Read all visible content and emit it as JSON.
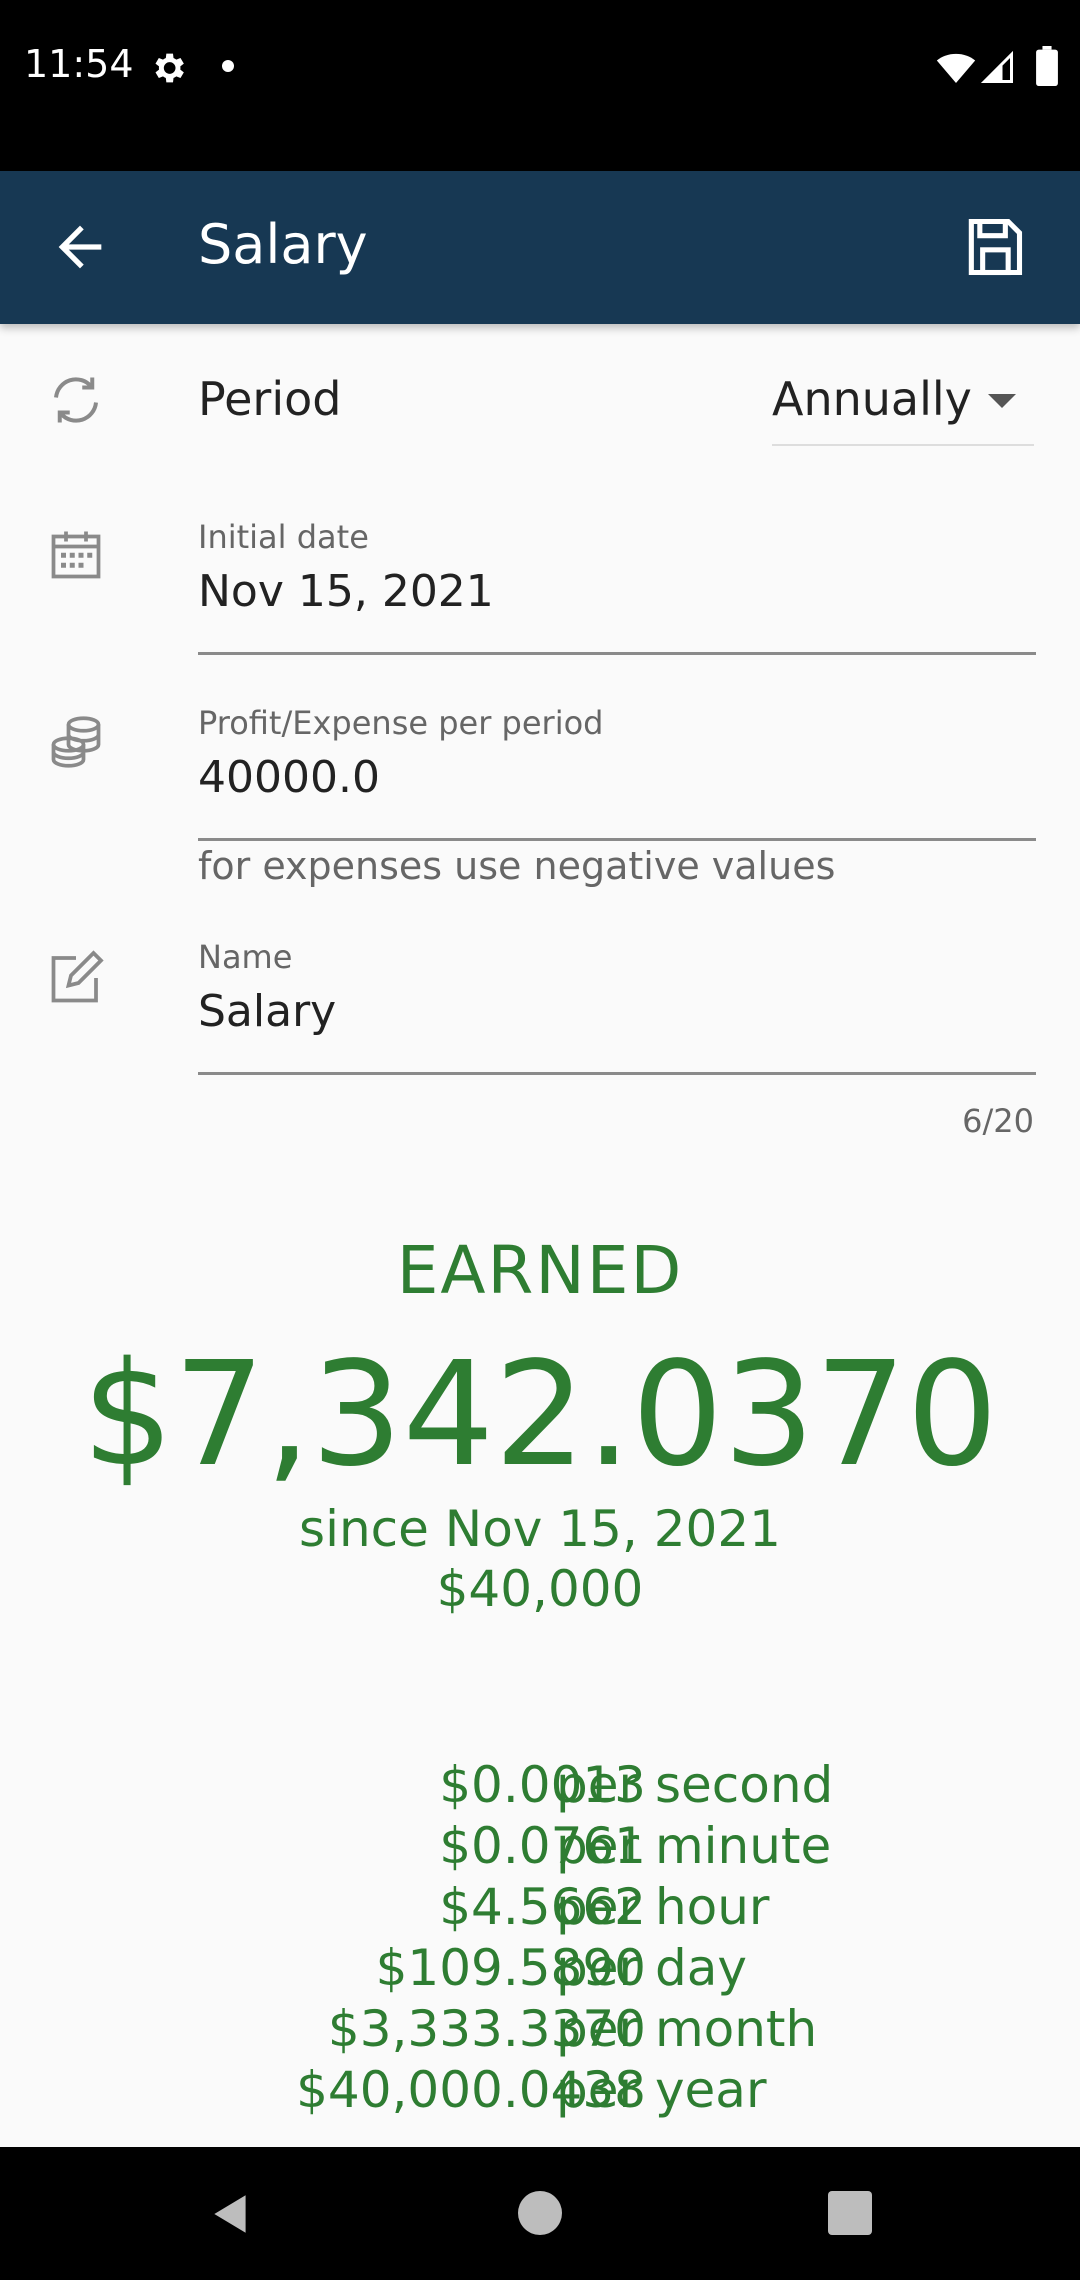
{
  "status_bar": {
    "time": "11:54"
  },
  "app_bar": {
    "title": "Salary"
  },
  "form": {
    "period": {
      "label": "Period",
      "value": "Annually"
    },
    "initial_date": {
      "label": "Initial date",
      "value": "Nov 15, 2021"
    },
    "amount": {
      "label": "Profit/Expense per period",
      "value": "40000.0",
      "helper": "for expenses use negative values"
    },
    "name": {
      "label": "Name",
      "value": "Salary",
      "counter": "6/20"
    }
  },
  "summary": {
    "title": "EARNED",
    "amount": "$7,342.0370",
    "since": "since Nov 15, 2021",
    "base": "$40,000",
    "rates": [
      {
        "amount": "$0.0013",
        "unit": "per second"
      },
      {
        "amount": "$0.0761",
        "unit": "per minute"
      },
      {
        "amount": "$4.5662",
        "unit": "per hour"
      },
      {
        "amount": "$109.5890",
        "unit": "per day"
      },
      {
        "amount": "$3,333.3370",
        "unit": "per month"
      },
      {
        "amount": "$40,000.0438",
        "unit": "per year"
      }
    ]
  },
  "colors": {
    "app_bar": "#173853",
    "accent_green": "#2e7d32"
  }
}
